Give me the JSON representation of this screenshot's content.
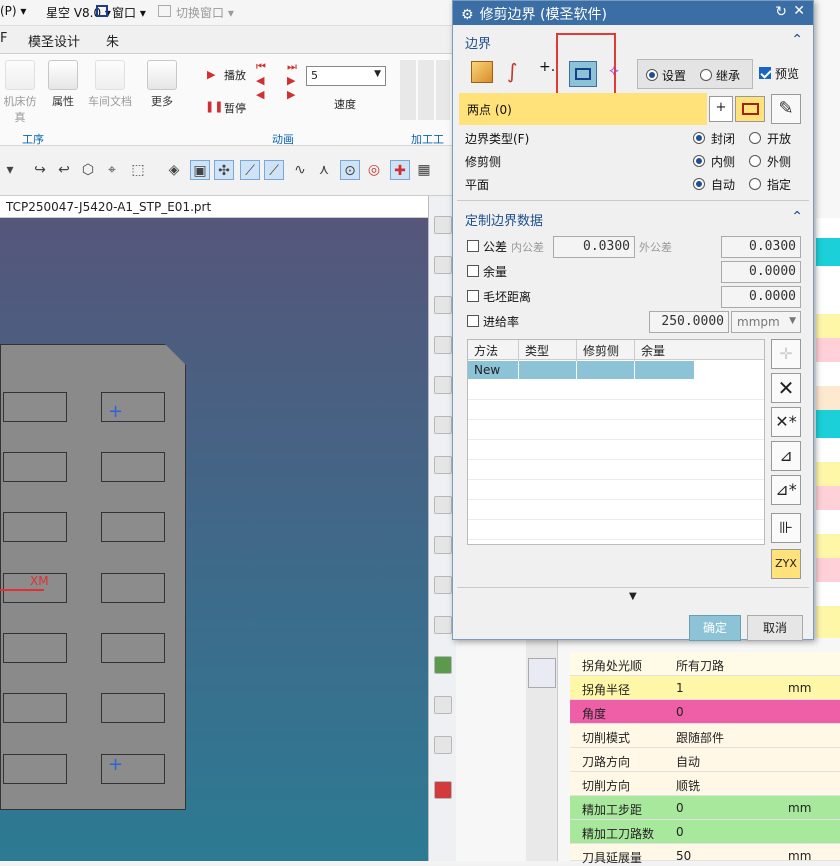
{
  "menubar": {
    "items": [
      "(P) ▾",
      "星空 V8.0 ▾",
      "窗口 ▾",
      "切换窗口 ▾"
    ]
  },
  "tabs": [
    "F",
    "模圣设计",
    "朱"
  ],
  "ribbon": {
    "buttons": [
      "机床仿真",
      "属性",
      "车间文档",
      "更多"
    ],
    "group_labels": [
      "工序",
      "动画",
      "加工工具"
    ],
    "play_label": "播放",
    "pause_label": "暂停",
    "speed_value": "5",
    "speed_label": "速度"
  },
  "file_tab": "TCP250047-J5420-A1_STP_E01.prt",
  "viewport": {
    "axis_label": "XM"
  },
  "dialog": {
    "title": "修剪边界  (模圣软件)",
    "boundary_section": "边界",
    "mode_settings": "设置",
    "mode_inherit": "继承",
    "preview_label": "预览",
    "two_points": "两点 (0)",
    "boundary_type_label": "边界类型(F)",
    "boundary_type_closed": "封闭",
    "boundary_type_open": "开放",
    "trim_side_label": "修剪侧",
    "trim_side_inside": "内侧",
    "trim_side_outside": "外侧",
    "plane_label": "平面",
    "plane_auto": "自动",
    "plane_specify": "指定",
    "custom_section": "定制边界数据",
    "tolerance_label": "公差",
    "inner_tol_label": "内公差",
    "inner_tol_value": "0.0300",
    "outer_tol_label": "外公差",
    "outer_tol_value": "0.0300",
    "stock_label": "余量",
    "stock_value": "0.0000",
    "blank_distance_label": "毛坯距离",
    "blank_distance_value": "0.0000",
    "feedrate_label": "进给率",
    "feedrate_value": "250.0000",
    "feed_unit": "mmpm",
    "table_headers": [
      "方法",
      "类型",
      "修剪侧",
      "余量"
    ],
    "table_rows": [
      [
        "New",
        "",
        "",
        ""
      ]
    ],
    "ok_label": "确定",
    "cancel_label": "取消"
  },
  "properties": [
    {
      "name": "拐角处光顺",
      "value": "所有刀路",
      "unit": "",
      "color": "#fffbe6"
    },
    {
      "name": "拐角半径",
      "value": "1",
      "unit": "mm",
      "color": "#fff7a8"
    },
    {
      "name": "角度",
      "value": "0",
      "unit": "",
      "color": "#ee5fa7"
    },
    {
      "name": "切削模式",
      "value": "跟随部件",
      "unit": "",
      "color": "#fff8e6"
    },
    {
      "name": "刀路方向",
      "value": "自动",
      "unit": "",
      "color": "#fff8e6"
    },
    {
      "name": "切削方向",
      "value": "顺铣",
      "unit": "",
      "color": "#fff8e6"
    },
    {
      "name": "精加工步距",
      "value": "0",
      "unit": "mm",
      "color": "#a8e89c"
    },
    {
      "name": "精加工刀路数",
      "value": "0",
      "unit": "",
      "color": "#a8e89c"
    },
    {
      "name": "刀具延展量",
      "value": "50",
      "unit": "mm",
      "color": "#fff8e6"
    }
  ],
  "colors": {
    "title_bar": "#3a6ea5",
    "highlight_yellow": "#ffe27a",
    "selection_red": "#e53935",
    "grid_selection": "#8cc3d6"
  }
}
